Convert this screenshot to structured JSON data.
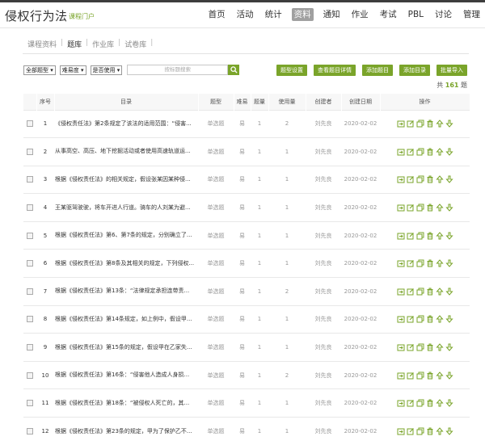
{
  "header": {
    "title": "侵权行为法",
    "portal": "课程门户",
    "nav": [
      "首页",
      "活动",
      "统计",
      "资料",
      "通知",
      "作业",
      "考试",
      "PBL",
      "讨论",
      "管理"
    ],
    "active_nav": "资料"
  },
  "subtabs": [
    "课程资料",
    "题库",
    "作业库",
    "试卷库"
  ],
  "active_subtab": "题库",
  "filters": {
    "type": "全部题型 ▾",
    "difficulty": "难易度 ▾",
    "used": "是否使用 ▾",
    "search_placeholder": "按标题搜索"
  },
  "buttons": [
    "题型设置",
    "查看题目详情",
    "添加题目",
    "添加目录",
    "批量导入"
  ],
  "total": {
    "prefix": "共",
    "count": "161",
    "suffix": "题"
  },
  "columns": [
    "序号",
    "目录",
    "题型",
    "难易",
    "题量",
    "使用量",
    "创建者",
    "创建日期",
    "操作"
  ],
  "rows": [
    {
      "no": "1",
      "title": "《侵权责任法》第2条规定了该法的适用范围：“侵害...",
      "type": "单选题",
      "level": "易",
      "qty": "1",
      "used": "2",
      "creator": "刘先良",
      "date": "2020-02-02"
    },
    {
      "no": "2",
      "title": "从事高空、高压、地下挖掘活动或者使用高速轨道运...",
      "type": "单选题",
      "level": "易",
      "qty": "1",
      "used": "1",
      "creator": "刘先良",
      "date": "2020-02-02"
    },
    {
      "no": "3",
      "title": "根据《侵权责任法》的相关规定，假设张某因某种侵...",
      "type": "单选题",
      "level": "易",
      "qty": "1",
      "used": "1",
      "creator": "刘先良",
      "date": "2020-02-02"
    },
    {
      "no": "4",
      "title": "王某驱驾驶驶，将车开进人行道。骑车的人刘某为避...",
      "type": "单选题",
      "level": "易",
      "qty": "1",
      "used": "1",
      "creator": "刘先良",
      "date": "2020-02-02"
    },
    {
      "no": "5",
      "title": "根据《侵权责任法》第6、第7条的规定，分别确立了...",
      "type": "单选题",
      "level": "易",
      "qty": "1",
      "used": "1",
      "creator": "刘先良",
      "date": "2020-02-02"
    },
    {
      "no": "6",
      "title": "根据《侵权责任法》第8条及其相关的规定，下列侵权...",
      "type": "单选题",
      "level": "易",
      "qty": "1",
      "used": "1",
      "creator": "刘先良",
      "date": "2020-02-02"
    },
    {
      "no": "7",
      "title": "根据《侵权责任法》第13条：“法律规定承担连带责...",
      "type": "单选题",
      "level": "易",
      "qty": "1",
      "used": "2",
      "creator": "刘先良",
      "date": "2020-02-02"
    },
    {
      "no": "8",
      "title": "根据《侵权责任法》第14条规定，如上例中，假设甲...",
      "type": "单选题",
      "level": "易",
      "qty": "1",
      "used": "1",
      "creator": "刘先良",
      "date": "2020-02-02"
    },
    {
      "no": "9",
      "title": "根据《侵权责任法》第15条的规定，假设甲在乙家失...",
      "type": "单选题",
      "level": "易",
      "qty": "1",
      "used": "1",
      "creator": "刘先良",
      "date": "2020-02-02"
    },
    {
      "no": "10",
      "title": "根据《侵权责任法》第16条：“侵害他人造成人身损...",
      "type": "单选题",
      "level": "易",
      "qty": "1",
      "used": "2",
      "creator": "刘先良",
      "date": "2020-02-02"
    },
    {
      "no": "11",
      "title": "根据《侵权责任法》第18条：“被侵权人死亡的，其...",
      "type": "单选题",
      "level": "易",
      "qty": "1",
      "used": "1",
      "creator": "刘先良",
      "date": "2020-02-02"
    },
    {
      "no": "12",
      "title": "根据《侵权责任法》第23条的规定，甲为了保护乙不...",
      "type": "单选题",
      "level": "易",
      "qty": "1",
      "used": "1",
      "creator": "刘先良",
      "date": "2020-02-02"
    }
  ],
  "colors": {
    "accent": "#7aa42a",
    "nav_active": "#a0a0a0"
  },
  "row_icons": [
    "move-icon",
    "edit-icon",
    "copy-icon",
    "delete-icon",
    "move-up-icon",
    "move-down-icon"
  ]
}
